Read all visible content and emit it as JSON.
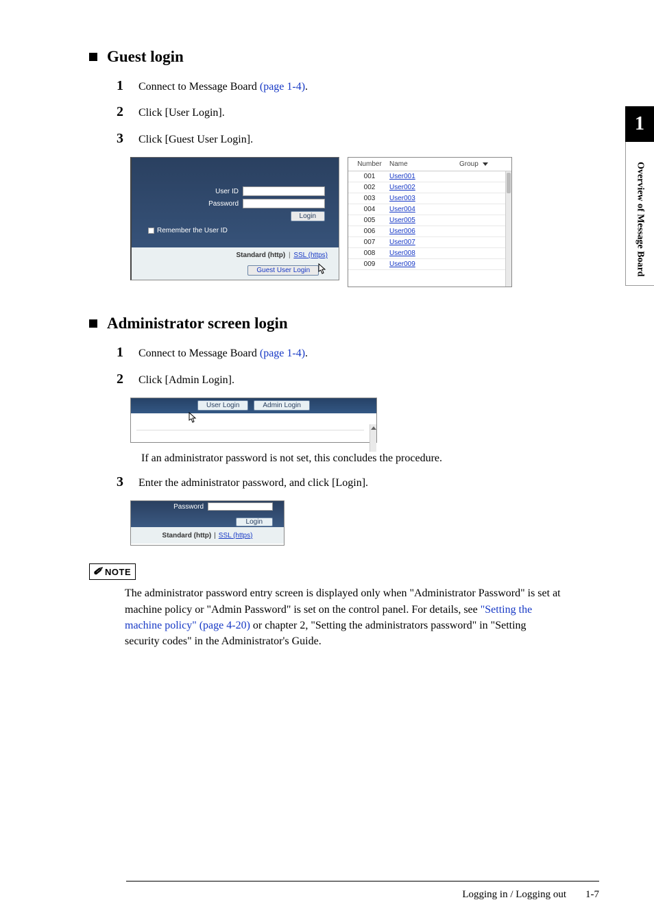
{
  "side": {
    "chapter_num": "1",
    "chapter_title": "Overview of Message Board"
  },
  "guest": {
    "title": "Guest login",
    "s1a": "Connect to Message Board ",
    "s1link": "(page 1-4)",
    "s1b": ".",
    "s2": "Click [User Login].",
    "s3": "Click [Guest User Login]."
  },
  "fig_login": {
    "user_id": "User ID",
    "password": "Password",
    "login": "Login",
    "remember": "Remember the User ID",
    "standard": "Standard (http)",
    "ssl": "SSL (https)",
    "guest": "Guest User Login"
  },
  "fig_list": {
    "col_number": "Number",
    "col_name": "Name",
    "col_group": "Group",
    "rows": [
      {
        "num": "001",
        "name": "User001"
      },
      {
        "num": "002",
        "name": "User002"
      },
      {
        "num": "003",
        "name": "User003"
      },
      {
        "num": "004",
        "name": "User004"
      },
      {
        "num": "005",
        "name": "User005"
      },
      {
        "num": "006",
        "name": "User006"
      },
      {
        "num": "007",
        "name": "User007"
      },
      {
        "num": "008",
        "name": "User008"
      },
      {
        "num": "009",
        "name": "User009"
      }
    ]
  },
  "admin": {
    "title": "Administrator screen login",
    "s1a": "Connect to Message Board ",
    "s1link": "(page 1-4)",
    "s1b": ".",
    "s2": "Click [Admin Login].",
    "tab_user": "User Login",
    "tab_admin": "Admin Login",
    "follow": "If an administrator password is not set, this concludes the procedure.",
    "s3": "Enter the administrator password, and click [Login].",
    "pw_label": "Password",
    "login": "Login",
    "standard": "Standard (http)",
    "ssl": "SSL (https)"
  },
  "note": {
    "label": "NOTE",
    "t1": "The administrator password entry screen is displayed only when \"Administrator Password\" is set at machine policy or \"Admin Password\" is set on the control panel. For details, see ",
    "link": "\"Setting the machine policy\" (page 4-20)",
    "t2": " or chapter 2, \"Setting the administrators password\" in \"Setting security codes\" in the Administrator's Guide."
  },
  "footer": {
    "section": "Logging in / Logging out",
    "page": "1-7"
  },
  "nums": {
    "n1": "1",
    "n2": "2",
    "n3": "3"
  }
}
